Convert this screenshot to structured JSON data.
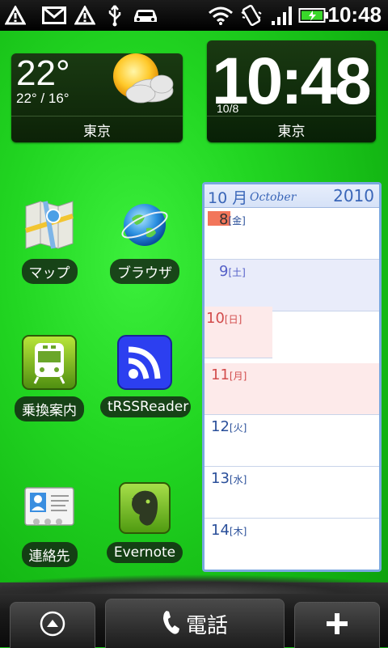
{
  "status_bar": {
    "time": "10:48",
    "icons": [
      "warning-icon",
      "gmail-icon",
      "warning-icon",
      "usb-icon",
      "car-icon",
      "wifi-icon",
      "vibrate-icon",
      "signal-icon",
      "battery-icon"
    ]
  },
  "weather_widget": {
    "temp": "22°",
    "range": "22° / 16°",
    "city": "東京"
  },
  "clock_widget": {
    "time": "10:48",
    "date": "10/8",
    "city": "東京"
  },
  "apps": [
    {
      "label": "マップ",
      "icon": "maps-icon"
    },
    {
      "label": "ブラウザ",
      "icon": "browser-icon"
    },
    {
      "label": "乗換案内",
      "icon": "train-icon"
    },
    {
      "label": "tRSSReader",
      "icon": "rss-icon"
    },
    {
      "label": "連絡先",
      "icon": "contacts-icon"
    },
    {
      "label": "Evernote",
      "icon": "evernote-icon"
    }
  ],
  "calendar": {
    "month": "10 月",
    "month_name": "October",
    "year": "2010",
    "days": [
      {
        "day": "8",
        "weekday": "[金]"
      },
      {
        "day": "9",
        "weekday": "[土]"
      },
      {
        "day": "10",
        "weekday": "[日]"
      },
      {
        "day": "11",
        "weekday": "[月]"
      },
      {
        "day": "12",
        "weekday": "[火]"
      },
      {
        "day": "13",
        "weekday": "[水]"
      },
      {
        "day": "14",
        "weekday": "[木]"
      }
    ]
  },
  "dock": {
    "phone_label": "電話",
    "left_icon": "up-arrow-icon",
    "right_icon": "plus-icon"
  }
}
